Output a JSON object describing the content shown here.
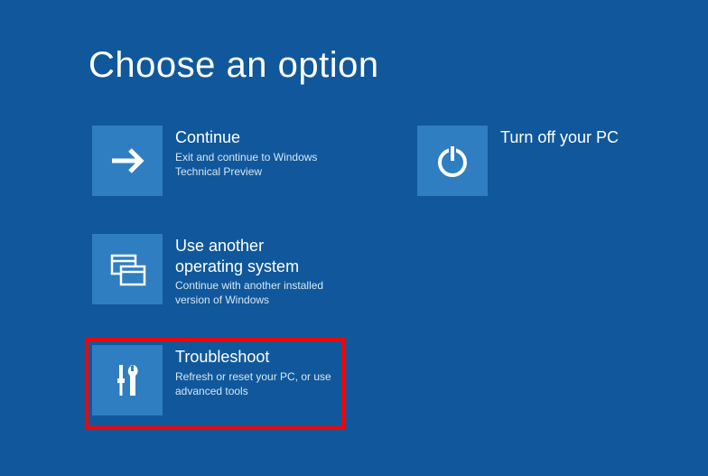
{
  "title": "Choose an option",
  "tiles": {
    "continue": {
      "title": "Continue",
      "desc": "Exit and continue to Windows Technical Preview"
    },
    "another_os": {
      "title": "Use another operating system",
      "desc": "Continue with another installed version of Windows"
    },
    "troubleshoot": {
      "title": "Troubleshoot",
      "desc": "Refresh or reset your PC, or use advanced tools"
    },
    "turnoff": {
      "title": "Turn off your PC",
      "desc": ""
    }
  }
}
